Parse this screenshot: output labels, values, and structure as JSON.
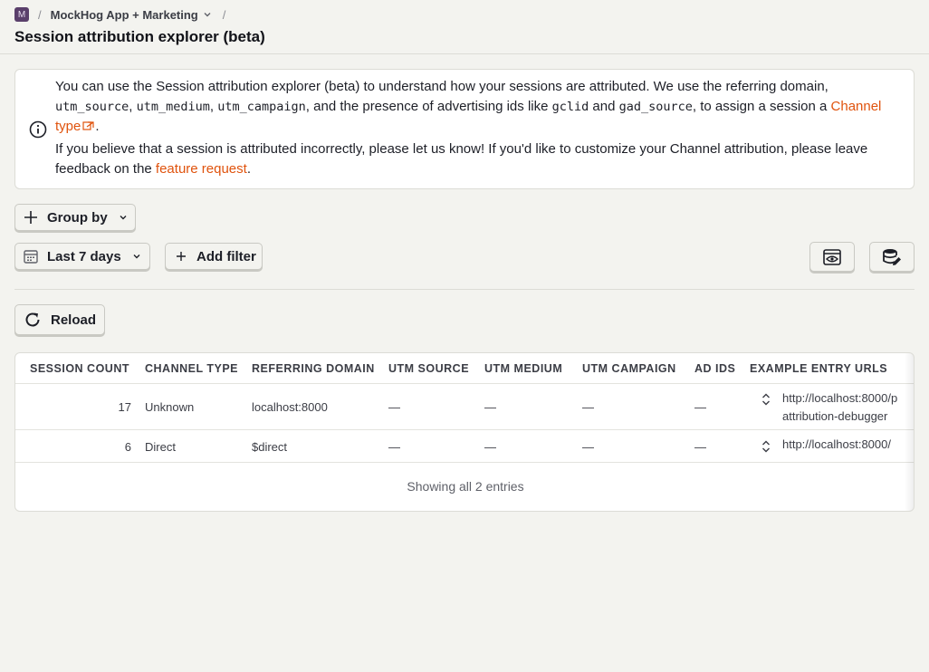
{
  "breadcrumb": {
    "project_initial": "M",
    "separator": "/",
    "project_name": "MockHog App + Marketing"
  },
  "page_title": "Session attribution explorer (beta)",
  "info": {
    "p1_a": "You can use the Session attribution explorer (beta) to understand how your sessions are attributed. We use the referring domain, ",
    "code_utm_source": "utm_source",
    "code_utm_medium": "utm_medium",
    "code_utm_campaign": "utm_campaign",
    "p1_b": ", and the presence of advertising ids like ",
    "code_gclid": "gclid",
    "p1_and": " and ",
    "code_gad_source": "gad_source",
    "p1_c": ", to assign a session a ",
    "channel_type_link": "Channel type",
    "p2_a": "If you believe that a session is attributed incorrectly, please let us know! If you'd like to customize your Channel attribution, please leave feedback on the ",
    "feature_request_link": "feature request"
  },
  "controls": {
    "group_by": "Group by",
    "date_range": "Last 7 days",
    "add_filter": "Add filter",
    "reload": "Reload"
  },
  "table": {
    "headers": [
      "SESSION COUNT",
      "CHANNEL TYPE",
      "REFERRING DOMAIN",
      "UTM SOURCE",
      "UTM MEDIUM",
      "UTM CAMPAIGN",
      "AD IDS",
      "EXAMPLE ENTRY URLS"
    ],
    "rows": [
      {
        "session_count": "17",
        "channel_type": "Unknown",
        "referring_domain": "localhost:8000",
        "utm_source": "—",
        "utm_medium": "—",
        "utm_campaign": "—",
        "ad_ids": "—",
        "url_line1": "http://localhost:8000/p",
        "url_line2": "attribution-debugger"
      },
      {
        "session_count": "6",
        "channel_type": "Direct",
        "referring_domain": "$direct",
        "utm_source": "—",
        "utm_medium": "—",
        "utm_campaign": "—",
        "ad_ids": "—",
        "url_line1": "http://localhost:8000/",
        "url_line2": ""
      }
    ],
    "footer": "Showing all 2 entries"
  },
  "colors": {
    "link": "#e0530d",
    "project_badge": "#5a3f6b",
    "background": "#f3f3ef"
  },
  "icons": [
    "info-icon",
    "external-link-icon",
    "plus-icon",
    "chevron-down-icon",
    "calendar-icon",
    "eye-icon",
    "database-edit-icon",
    "reload-icon",
    "expand-icon"
  ]
}
